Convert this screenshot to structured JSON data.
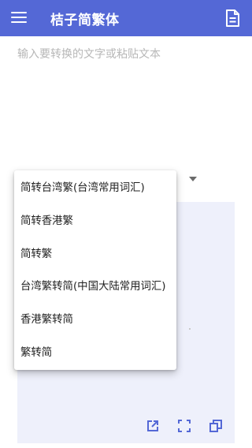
{
  "app": {
    "title": "桔子简繁体"
  },
  "input": {
    "placeholder": "输入要转换的文字或粘贴文本"
  },
  "dropdown": {
    "options": [
      "简转台湾繁(台湾常用词汇)",
      "简转香港繁",
      "简转繁",
      "台湾繁转简(中国大陆常用词汇)",
      "香港繁转简",
      "繁转简"
    ]
  },
  "icons": {
    "menu": "menu-icon",
    "document": "document-icon",
    "share": "open-external-icon",
    "fullscreen": "fullscreen-icon",
    "copy": "copy-icon"
  },
  "colors": {
    "appbar": "#5468d6",
    "output_background": "#eef0fb",
    "icon_accent": "#5468d6"
  }
}
